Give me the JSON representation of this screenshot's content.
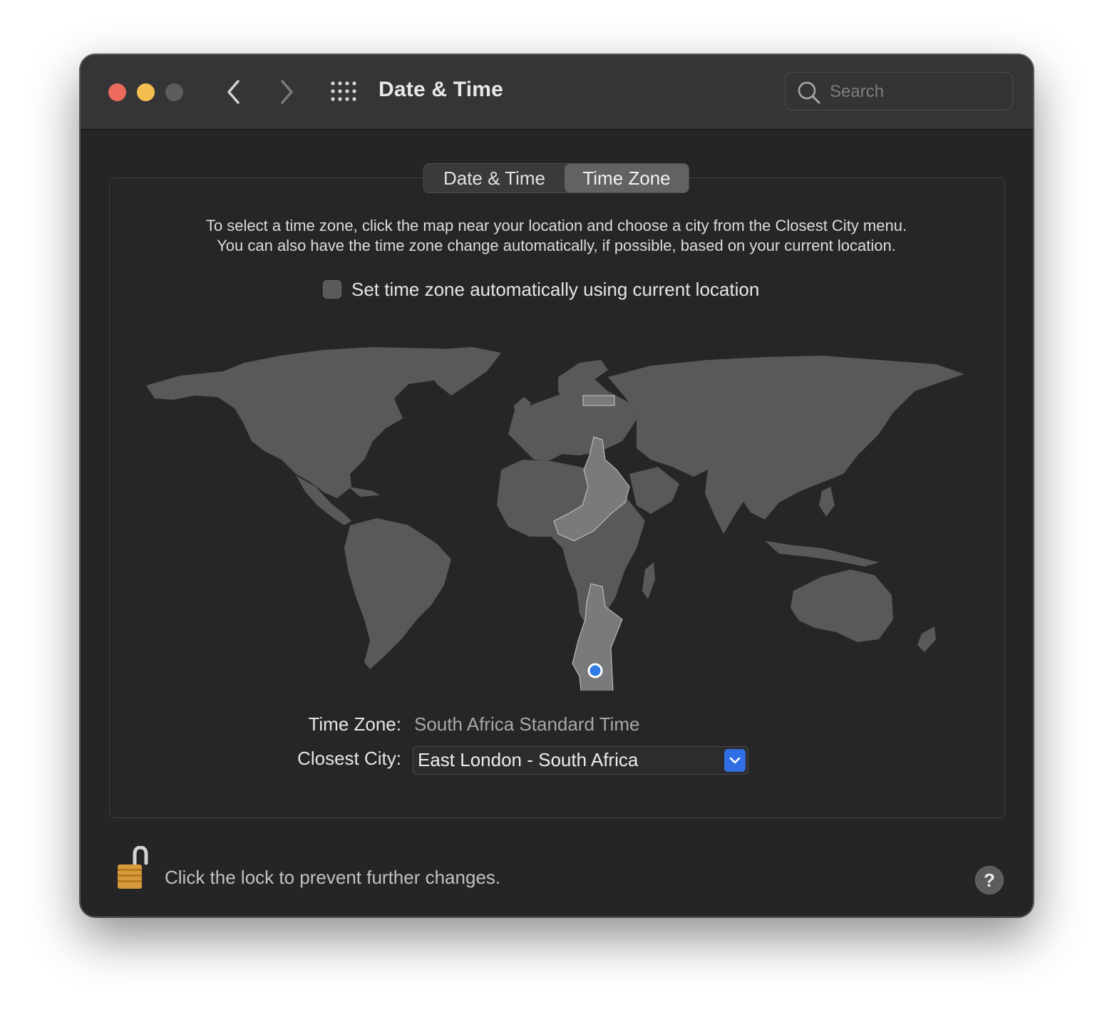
{
  "window": {
    "title": "Date & Time",
    "traffic_lights": {
      "close": "#ed6a5e",
      "minimize": "#f5bf4f",
      "zoom": "#5d5d5f"
    },
    "nav": {
      "back_icon": "chevron-left-icon",
      "forward_icon": "chevron-right-icon",
      "grid_icon": "grid-icon"
    },
    "search": {
      "placeholder": "Search",
      "value": ""
    }
  },
  "tabs": [
    {
      "label": "Date & Time",
      "selected": false
    },
    {
      "label": "Time Zone",
      "selected": true
    }
  ],
  "instructions": {
    "line1": "To select a time zone, click the map near your location and choose a city from the Closest City menu.",
    "line2": "You can also have the time zone change automatically, if possible, based on your current location."
  },
  "auto_timezone": {
    "label": "Set time zone automatically using current location",
    "checked": false
  },
  "map": {
    "selected_location_color": "#2f7ae5",
    "land_color": "#59595b",
    "highlight_color": "#78787a"
  },
  "fields": {
    "time_zone_label": "Time Zone:",
    "time_zone_value": "South Africa Standard Time",
    "closest_city_label": "Closest City:",
    "closest_city_value": "East London - South Africa"
  },
  "footer": {
    "lock_text": "Click the lock to prevent further changes.",
    "help_label": "?"
  }
}
